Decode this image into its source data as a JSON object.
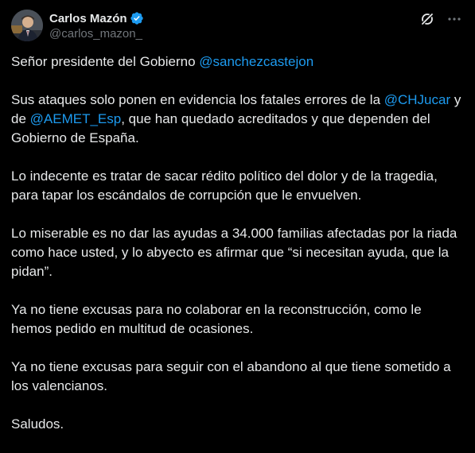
{
  "author": {
    "display_name": "Carlos Mazón",
    "handle": "@carlos_mazon_",
    "verified": true,
    "verified_color": "#1d9bf0"
  },
  "header_actions": {
    "grok_icon": "grok-icon",
    "more_icon": "more-options-icon"
  },
  "tweet": {
    "p1": {
      "text": "Señor presidente del Gobierno ",
      "mention": "@sanchezcastejon"
    },
    "p2": {
      "text_a": "Sus ataques solo ponen en evidencia los fatales errores de la ",
      "mention_a": "@CHJucar",
      "text_b": " y de ",
      "mention_b": "@AEMET_Esp",
      "text_c": ", que han quedado acreditados y que dependen del Gobierno de España."
    },
    "p3": "Lo indecente es tratar de sacar rédito político del dolor y de la tragedia, para tapar los escándalos de corrupción que le envuelven.",
    "p4": "Lo miserable es no dar las ayudas a 34.000 familias afectadas por la riada como hace usted, y lo abyecto es afirmar que “si necesitan ayuda, que la pidan”.",
    "p5": "Ya no tiene excusas para no colaborar en la reconstrucción, como le hemos pedido en multitud de ocasiones.",
    "p6": "Ya no tiene excusas para seguir con el abandono al que tiene sometido a los valencianos.",
    "p7": "Saludos."
  },
  "colors": {
    "background": "#000000",
    "text": "#e7e9ea",
    "secondary_text": "#71767b",
    "link": "#1d9bf0"
  }
}
